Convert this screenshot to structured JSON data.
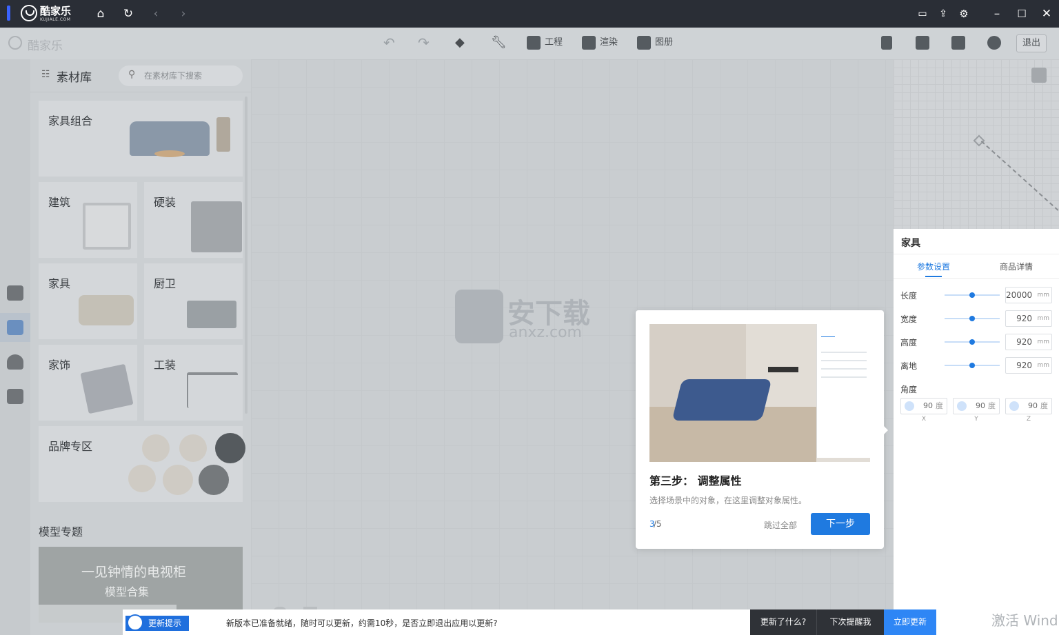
{
  "titlebar": {
    "brand": "酷家乐",
    "brand_sub": "KUJIALE.COM",
    "nav_icons": [
      "home-icon",
      "refresh-icon",
      "back-icon",
      "forward-icon"
    ],
    "right_icons": [
      "message-icon",
      "share-icon",
      "settings-icon",
      "minimize-icon",
      "maximize-icon",
      "close-icon"
    ]
  },
  "toolbar": {
    "logo": "酷家乐",
    "project": "工程",
    "render": "渲染",
    "album": "图册",
    "exit": "退出"
  },
  "library": {
    "title": "素材库",
    "search_placeholder": "在素材库下搜索",
    "tiles": {
      "furniture_combo": "家具组合",
      "architecture": "建筑",
      "hard_decor": "硬装",
      "furniture": "家具",
      "kitchen_bath": "厨卫",
      "home_decor": "家饰",
      "tooling": "工装",
      "brand_zone": "品牌专区"
    },
    "model_topic": "模型专题",
    "banner_title": "一见钟情的电视柜",
    "banner_sub": "模型合集"
  },
  "watermark": {
    "cn": "安下载",
    "en": "anxz.com"
  },
  "properties": {
    "title": "家具",
    "tabs": [
      "参数设置",
      "商品详情"
    ],
    "active_tab": 0,
    "rows": [
      {
        "label": "长度",
        "value": "20000",
        "unit": "mm"
      },
      {
        "label": "宽度",
        "value": "920",
        "unit": "mm"
      },
      {
        "label": "高度",
        "value": "920",
        "unit": "mm"
      },
      {
        "label": "离地",
        "value": "920",
        "unit": "mm"
      }
    ],
    "angle_label": "角度",
    "angles": [
      {
        "value": "90",
        "unit": "度",
        "axis": "X"
      },
      {
        "value": "90",
        "unit": "度",
        "axis": "Y"
      },
      {
        "value": "90",
        "unit": "度",
        "axis": "Z"
      }
    ]
  },
  "tutorial": {
    "step_title": "第三步： 调整属性",
    "description": "选择场景中的对象，在这里调整对象属性。",
    "page_current": "3",
    "page_total": "/5",
    "skip": "跳过全部",
    "next": "下一步"
  },
  "update_bar": {
    "badge": "更新提示",
    "message": "新版本已准备就绪，随时可以更新，约需10秒，是否立即退出应用以更新?",
    "whats_new": "更新了什么?",
    "remind_later": "下次提醒我",
    "update_now": "立即更新"
  },
  "activate_windows": "激活 Wind",
  "colors": {
    "accent": "#1f7ae0",
    "titlebar": "#2a2e36"
  }
}
